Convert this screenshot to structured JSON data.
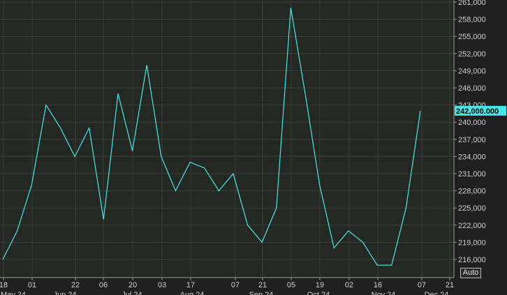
{
  "chart_data": {
    "type": "line",
    "series": [
      {
        "color": "#45e8e8",
        "values": [
          216000,
          221000,
          229000,
          243000,
          239000,
          234000,
          239000,
          223000,
          245000,
          235000,
          250000,
          234000,
          228000,
          233000,
          232000,
          228000,
          231000,
          222000,
          219000,
          225000,
          260000,
          245000,
          229000,
          218000,
          221000,
          219000,
          215000,
          215000,
          225000,
          242000
        ]
      }
    ],
    "ylim": [
      213000,
      261500
    ],
    "yticks": [
      "216,000",
      "219,000",
      "222,000",
      "225,000",
      "228,000",
      "231,000",
      "234,000",
      "237,000",
      "240,000",
      "243,000",
      "246,000",
      "249,000",
      "252,000",
      "255,000",
      "258,000",
      "261,000"
    ],
    "xtick_days": [
      "18",
      "01",
      "22",
      "06",
      "20",
      "03",
      "17",
      "07",
      "21",
      "05",
      "19",
      "02",
      "16",
      "07",
      "21"
    ],
    "xtick_months": [
      "May 24",
      "Jun 24",
      "Jul 24",
      "Aug 24",
      "Sep 24",
      "Oct 24",
      "Nov 24",
      "Dec 24"
    ],
    "last_value_label": "242,000.000",
    "grid": true,
    "colors": {
      "background": "#1f1f1f",
      "plot": "#232822",
      "grid": "#3d3d3d",
      "line": "#45e8e8",
      "text": "#cfcfcf"
    }
  },
  "controls": {
    "auto_label": "Auto"
  }
}
